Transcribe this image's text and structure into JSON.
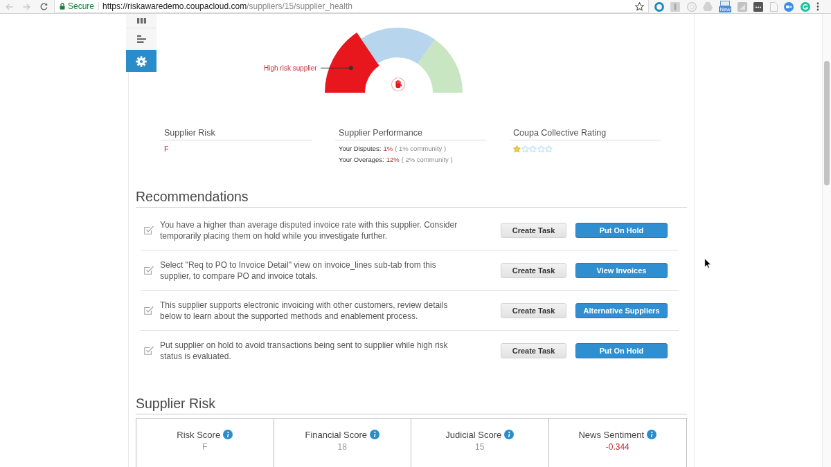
{
  "browser": {
    "secure_label": "Secure",
    "url_host": "https://riskawaredemo.coupacloud.com",
    "url_path": "/suppliers/15/supplier_health",
    "badge": "New"
  },
  "sidebar": {
    "items": [
      {
        "kind": "columns",
        "selected": false
      },
      {
        "kind": "bars",
        "selected": false
      },
      {
        "kind": "gear",
        "selected": true
      }
    ]
  },
  "gauge": {
    "label": "High risk supplier",
    "zones": [
      {
        "color": "#e8161d",
        "selected": true
      },
      {
        "color": "#b7d5ec",
        "selected": false
      },
      {
        "color": "#c8e6c2",
        "selected": false
      }
    ]
  },
  "summary": [
    {
      "kind": "grade",
      "title": "Supplier Risk",
      "value": "F",
      "negative": true
    },
    {
      "kind": "stats",
      "title": "Supplier Performance",
      "lines": [
        {
          "label": "Your Disputes:",
          "value": "1%",
          "note": "( 1% community )"
        },
        {
          "label": "Your Overages:",
          "value": "12%",
          "note": "( 2% community )"
        }
      ]
    },
    {
      "kind": "rating",
      "title": "Coupa Collective Rating",
      "stars": 1
    }
  ],
  "recommendations": {
    "title": "Recommendations",
    "items": [
      {
        "text": "You have a higher than average disputed invoice rate with this supplier. Consider temporarily placing them on hold while you investigate further.",
        "actions": [
          {
            "kind": "secondary",
            "label": "Create Task"
          },
          {
            "kind": "primary",
            "label": "Put On Hold"
          }
        ]
      },
      {
        "text": "Select \"Req to PO to Invoice Detail\" view on invoice_lines sub-tab from this supplier, to compare PO and invoice totals.",
        "actions": [
          {
            "kind": "secondary",
            "label": "Create Task"
          },
          {
            "kind": "primary",
            "label": "View Invoices"
          }
        ]
      },
      {
        "text": "This supplier supports electronic invoicing with other customers, review details below to learn about the supported methods and enablement process.",
        "actions": [
          {
            "kind": "secondary",
            "label": "Create Task"
          },
          {
            "kind": "primary",
            "label": "Alternative Suppliers"
          }
        ]
      },
      {
        "text": "Put supplier on hold to avoid transactions being sent to supplier while high risk status is evaluated.",
        "actions": [
          {
            "kind": "secondary",
            "label": "Create Task"
          },
          {
            "kind": "primary",
            "label": "Put On Hold"
          }
        ]
      }
    ]
  },
  "supplier_risk": {
    "title": "Supplier Risk",
    "scores": [
      {
        "label": "Risk Score",
        "value": "F",
        "negative": false
      },
      {
        "label": "Financial Score",
        "value": "18",
        "negative": false
      },
      {
        "label": "Judicial Score",
        "value": "15",
        "negative": false
      },
      {
        "label": "News Sentiment",
        "value": "-0.344",
        "negative": true
      }
    ]
  }
}
